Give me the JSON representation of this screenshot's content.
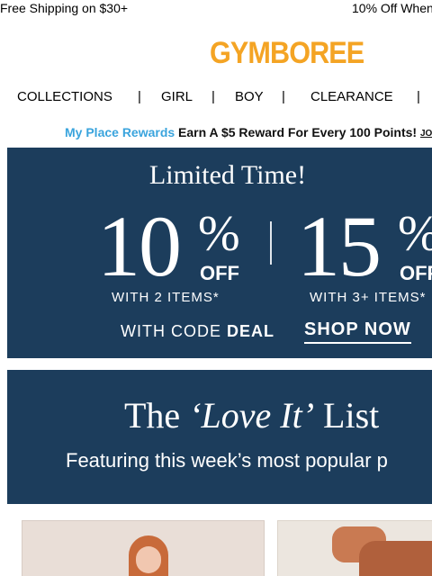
{
  "promo_bar": {
    "left_text": "Free Shipping on $30+",
    "right_text": "10% Off When"
  },
  "brand": {
    "logo_text": "GYMBOREE"
  },
  "nav": {
    "items": [
      "COLLECTIONS",
      "GIRL",
      "BOY",
      "CLEARANCE"
    ],
    "separator": "|"
  },
  "rewards": {
    "program_name": "My Place Rewards",
    "message": "Earn A $5 Reward For Every 100 Points!",
    "join_label": "JO"
  },
  "banner_sale": {
    "title": "Limited Time!",
    "offer1_number": "10",
    "offer1_percent": "%",
    "offer1_off": "OFF",
    "offer1_condition": "WITH 2 ITEMS*",
    "offer2_number": "15",
    "offer2_percent": "%",
    "offer2_off": "OFF",
    "offer2_condition": "WITH 3+ ITEMS*",
    "code_prefix": "WITH CODE",
    "code": "DEAL",
    "cta": "SHOP NOW"
  },
  "banner_love": {
    "title_prefix": "The",
    "title_italic": "‘Love It’",
    "title_suffix": "List",
    "subtitle": "Featuring this week’s most popular p"
  },
  "colors": {
    "banner_bg": "#1c3d5c",
    "logo": "#f4a424",
    "rewards_brand": "#3aa4dd"
  }
}
